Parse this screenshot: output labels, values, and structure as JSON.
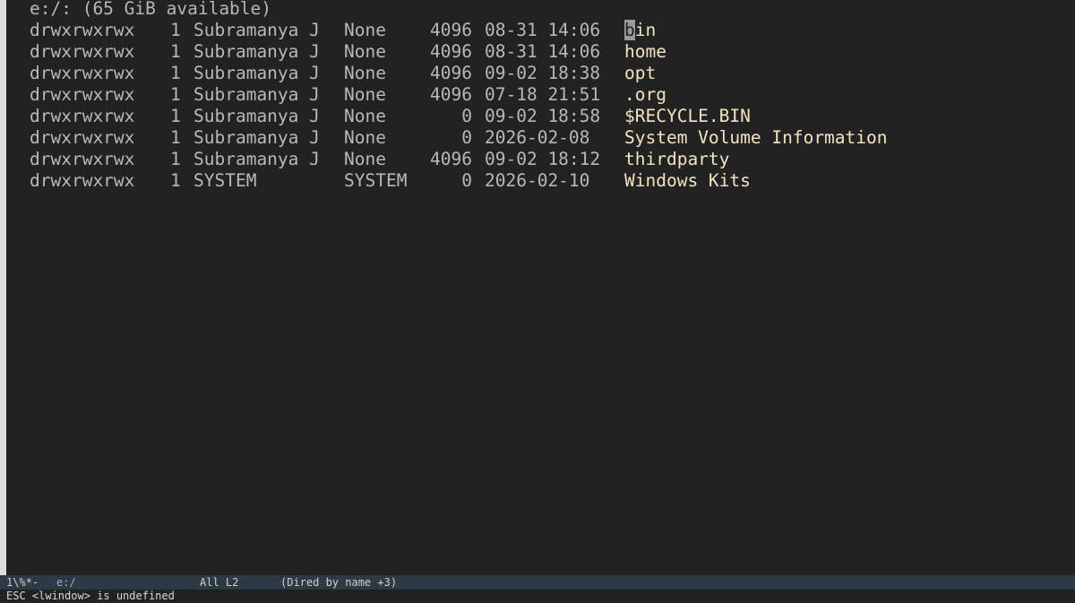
{
  "dired": {
    "header": "e:/: (65 GiB available)",
    "cursor_row": 0,
    "entries": [
      {
        "perms": "drwxrwxrwx",
        "links": "1",
        "owner": "Subramanya J",
        "group": "None",
        "size": "4096",
        "date": "08-31 14:06",
        "name": "bin"
      },
      {
        "perms": "drwxrwxrwx",
        "links": "1",
        "owner": "Subramanya J",
        "group": "None",
        "size": "4096",
        "date": "08-31 14:06",
        "name": "home"
      },
      {
        "perms": "drwxrwxrwx",
        "links": "1",
        "owner": "Subramanya J",
        "group": "None",
        "size": "4096",
        "date": "09-02 18:38",
        "name": "opt"
      },
      {
        "perms": "drwxrwxrwx",
        "links": "1",
        "owner": "Subramanya J",
        "group": "None",
        "size": "4096",
        "date": "07-18 21:51",
        "name": ".org"
      },
      {
        "perms": "drwxrwxrwx",
        "links": "1",
        "owner": "Subramanya J",
        "group": "None",
        "size": "0",
        "date": "09-02 18:58",
        "name": "$RECYCLE.BIN"
      },
      {
        "perms": "drwxrwxrwx",
        "links": "1",
        "owner": "Subramanya J",
        "group": "None",
        "size": "0",
        "date": "2026-02-08",
        "name": "System Volume Information"
      },
      {
        "perms": "drwxrwxrwx",
        "links": "1",
        "owner": "Subramanya J",
        "group": "None",
        "size": "4096",
        "date": "09-02 18:12",
        "name": "thirdparty"
      },
      {
        "perms": "drwxrwxrwx",
        "links": "1",
        "owner": "SYSTEM",
        "group": "SYSTEM",
        "size": "0",
        "date": "2026-02-10",
        "name": "Windows Kits"
      }
    ]
  },
  "mode_line": {
    "status": "1\\%*-",
    "buffer_name": "e:/",
    "position": "All L2",
    "mode": "(Dired by name +3)"
  },
  "echo_area": {
    "message": "ESC <lwindow> is undefined"
  }
}
